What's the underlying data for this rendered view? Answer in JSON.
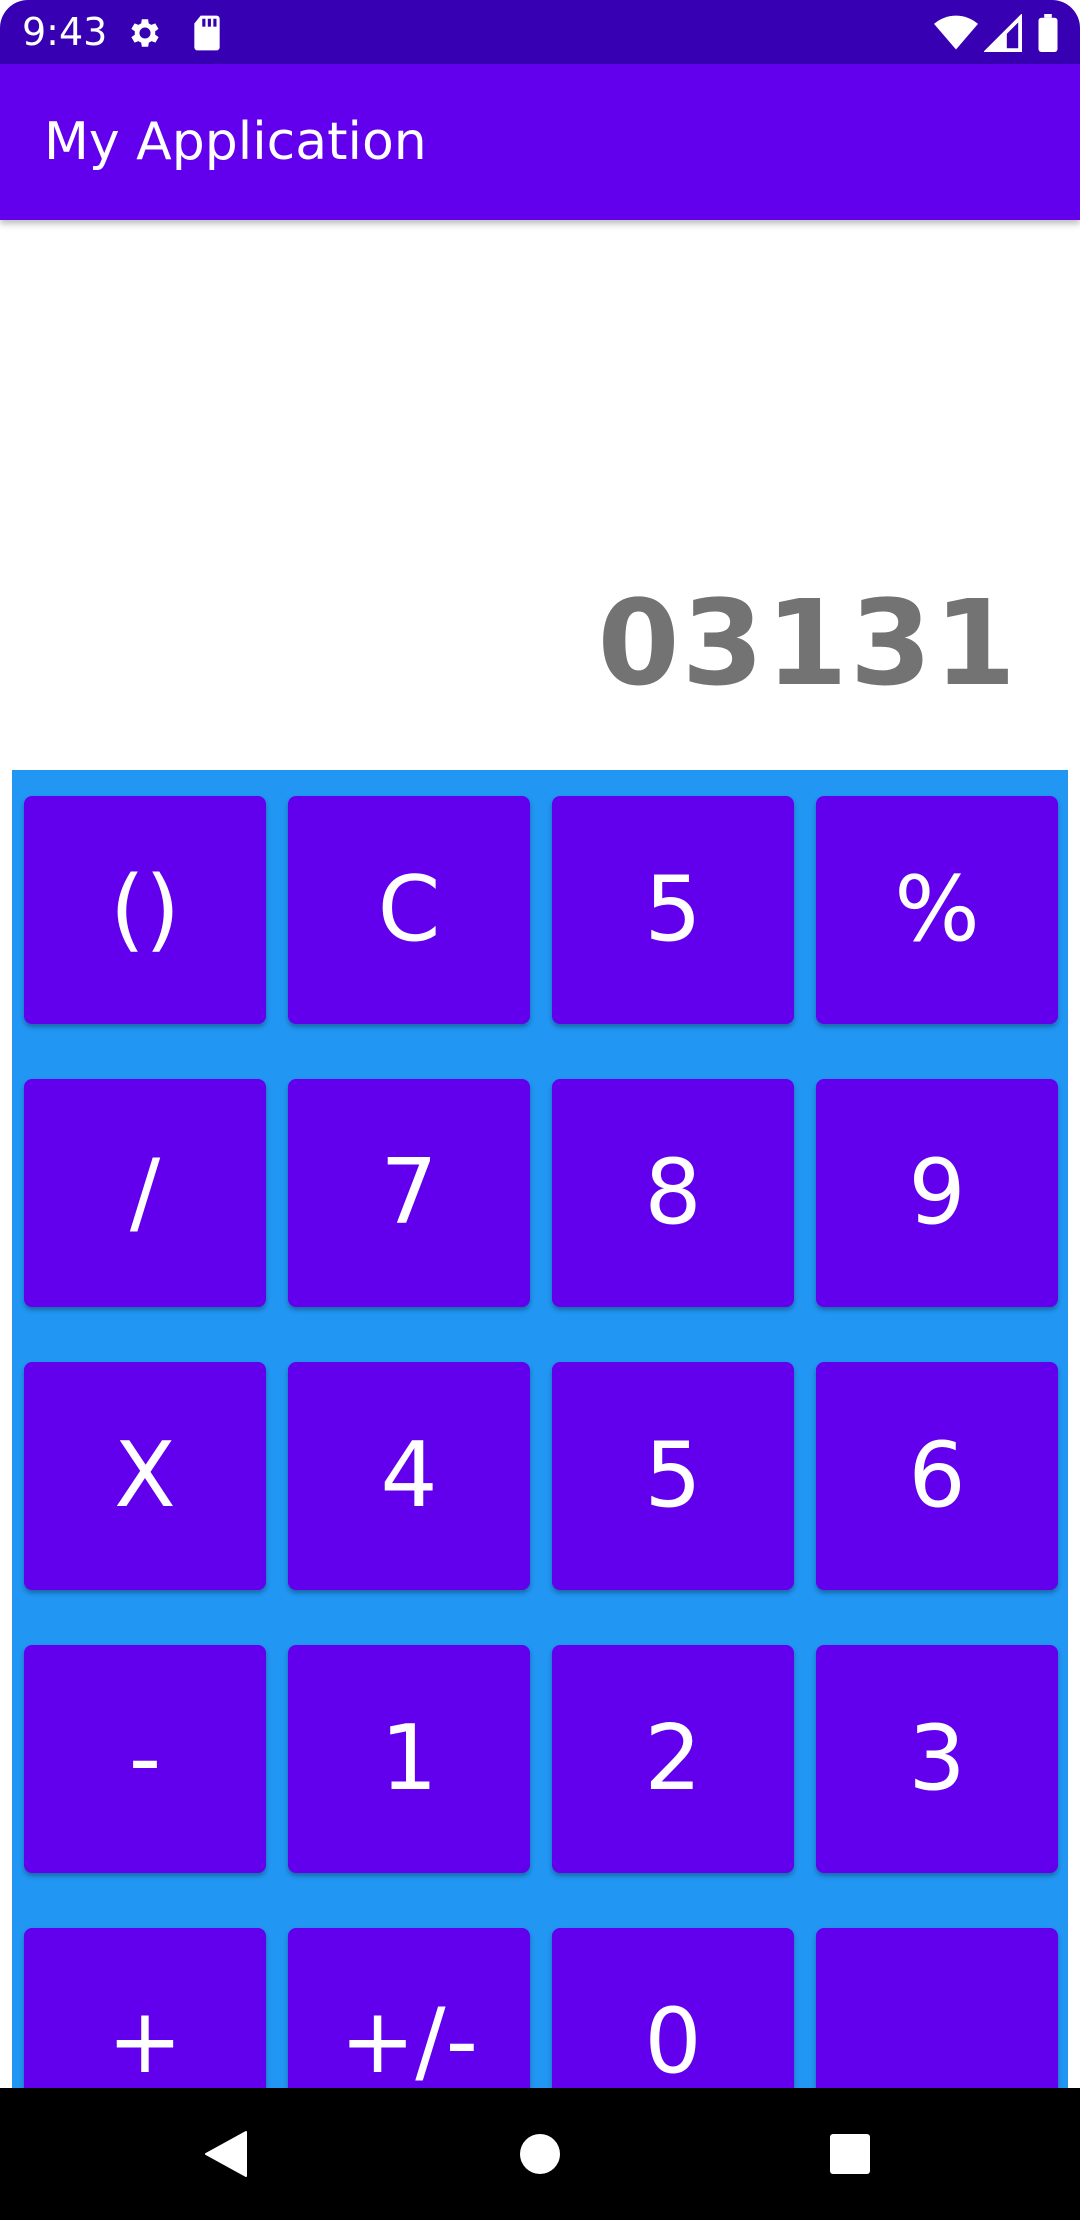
{
  "status_bar": {
    "time": "9:43",
    "icons": [
      "gear-icon",
      "sd-card-icon",
      "wifi-icon",
      "cell-signal-icon",
      "battery-icon"
    ]
  },
  "app_bar": {
    "title": "My Application"
  },
  "display": {
    "value": "03131"
  },
  "keypad": {
    "rows": [
      [
        "()",
        "C",
        "5",
        "%"
      ],
      [
        "/",
        "7",
        "8",
        "9"
      ],
      [
        "X",
        "4",
        "5",
        "6"
      ],
      [
        "-",
        "1",
        "2",
        "3"
      ],
      [
        "+",
        "+/-",
        "0",
        "."
      ]
    ]
  },
  "colors": {
    "status_bar": "#3700b3",
    "app_bar": "#6200ee",
    "keypad_bg": "#2196f3",
    "key_bg": "#6200ee",
    "display_text": "#737373"
  },
  "nav_bar": {
    "icons": [
      "back-icon",
      "home-icon",
      "recents-icon"
    ]
  }
}
